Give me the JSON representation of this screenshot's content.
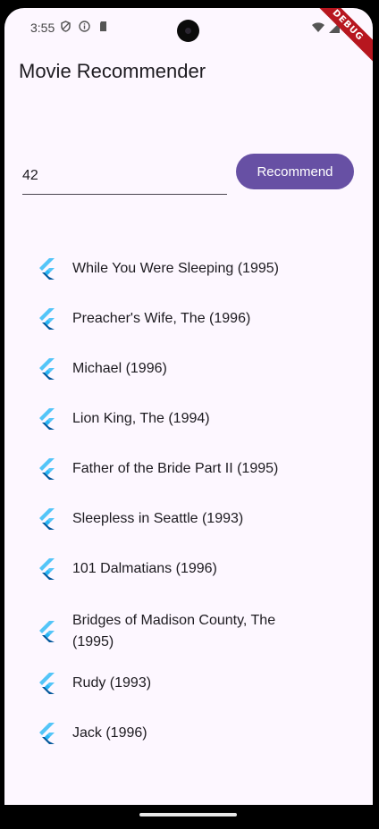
{
  "status_bar": {
    "time": "3:55",
    "debug_label": "DEBUG"
  },
  "app": {
    "title": "Movie Recommender"
  },
  "input": {
    "value": "42"
  },
  "recommend_button": {
    "label": "Recommend"
  },
  "colors": {
    "primary": "#6750a4",
    "background": "#fdf7ff",
    "flutter_blue_light": "#54c5f8",
    "flutter_blue_dark": "#01579b"
  },
  "movies": [
    {
      "title": "While You Were Sleeping (1995)",
      "icon": "flutter-icon"
    },
    {
      "title": "Preacher's Wife, The (1996)",
      "icon": "flutter-icon"
    },
    {
      "title": "Michael (1996)",
      "icon": "flutter-icon"
    },
    {
      "title": "Lion King, The (1994)",
      "icon": "flutter-icon"
    },
    {
      "title": "Father of the Bride Part II (1995)",
      "icon": "flutter-icon"
    },
    {
      "title": "Sleepless in Seattle (1993)",
      "icon": "flutter-icon"
    },
    {
      "title": "101 Dalmatians (1996)",
      "icon": "flutter-icon"
    },
    {
      "title": "Bridges of Madison County, The (1995)",
      "icon": "flutter-icon"
    },
    {
      "title": "Rudy (1993)",
      "icon": "flutter-icon"
    },
    {
      "title": "Jack (1996)",
      "icon": "flutter-icon"
    }
  ]
}
